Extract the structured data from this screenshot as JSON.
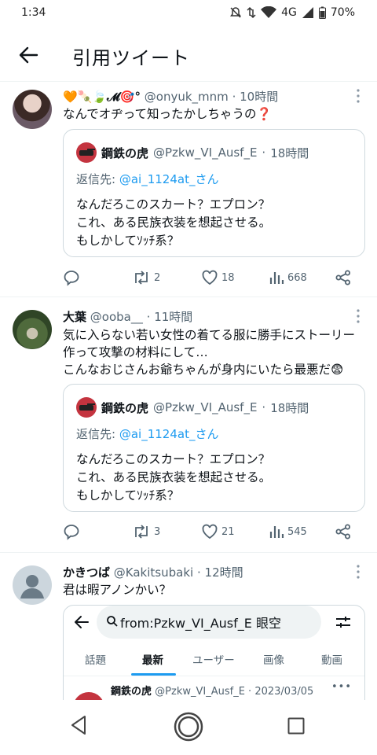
{
  "status_bar": {
    "time": "1:34",
    "network": "4G",
    "battery": "70%"
  },
  "app_bar": {
    "title": "引用ツイート"
  },
  "tweets": [
    {
      "name": "🧡🍡🍃𝓜🎯°",
      "handle": "@onyuk_mnm",
      "time": "10時間",
      "text": "なんでオヂって知ったかしちゃうの❓",
      "quote": {
        "name": "鋼鉄の虎",
        "handle": "@Pzkw_VI_Ausf_E",
        "time": "18時間",
        "reply_label": "返信先:",
        "reply_handle": "@ai_1124at_さん",
        "lines": [
          "なんだろこのスカート？エプロン？",
          "これ、ある民族衣装を想起させる。",
          "もしかしてｿｯﾁ系？"
        ]
      },
      "retweets": "2",
      "likes": "18",
      "views": "668"
    },
    {
      "name": "大葉",
      "handle": "@ooba__",
      "time": "11時間",
      "lines": [
        "気に入らない若い女性の着てる服に勝手にストーリー",
        "作って攻撃の材料にして…",
        "こんなおじさんお爺ちゃんが身内にいたら最悪だ😨"
      ],
      "quote": {
        "name": "鋼鉄の虎",
        "handle": "@Pzkw_VI_Ausf_E",
        "time": "18時間",
        "reply_label": "返信先:",
        "reply_handle": "@ai_1124at_さん",
        "lines": [
          "なんだろこのスカート？エプロン？",
          "これ、ある民族衣装を想起させる。",
          "もしかしてｿｯﾁ系？"
        ]
      },
      "retweets": "3",
      "likes": "21",
      "views": "545"
    },
    {
      "name": "かきつば",
      "handle": "@Kakitsubaki",
      "time": "12時間",
      "text": "君は暇アノンかい？",
      "screenshot": {
        "search_query": "from:Pzkw_VI_Ausf_E 眼空",
        "tabs": [
          "話題",
          "最新",
          "ユーザー",
          "画像",
          "動画"
        ],
        "active_tab": "最新",
        "sub_name": "鋼鉄の虎",
        "sub_handle": "@Pzkw_VI_Ausf_E",
        "sub_date": "2023/03/05"
      }
    }
  ],
  "separator": "·",
  "colors": {
    "accent": "#1d9bf0",
    "secondary_text": "#536471",
    "border": "#cfd9de"
  }
}
